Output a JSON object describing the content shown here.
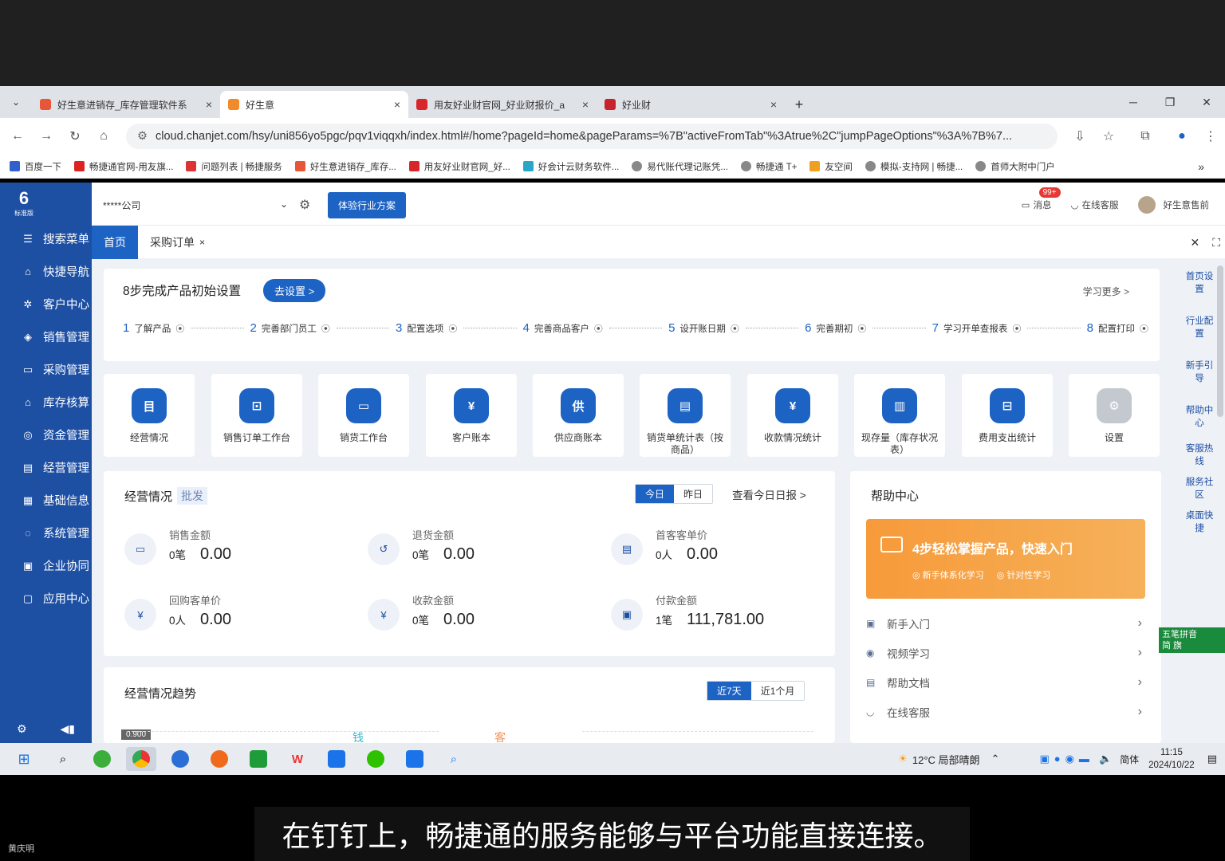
{
  "browser": {
    "tabs": [
      {
        "label": "好生意进销存_库存管理软件系",
        "color": "#e8563a"
      },
      {
        "label": "好生意",
        "color": "#f08a2a"
      },
      {
        "label": "用友好业财官网_好业财报价_a",
        "color": "#d8262b"
      },
      {
        "label": "好业财",
        "color": "#c8222d"
      }
    ],
    "url": "cloud.chanjet.com/hsy/uni856yo5pgc/pqv1viqqxh/index.html#/home?pageId=home&pageParams=%7B\"activeFromTab\"%3Atrue%2C\"jumpPageOptions\"%3A%7B%7...",
    "bookmarks": [
      "百度一下",
      "畅捷通官网-用友旗...",
      "问题列表 | 畅捷服务",
      "好生意进销存_库存...",
      "用友好业财官网_好...",
      "好会计云财务软件...",
      "易代账代理记账凭...",
      "畅捷通 T+",
      "友空间",
      "模拟-支持网 | 畅捷...",
      "首师大附中门户"
    ]
  },
  "sidebar": {
    "logo": "6",
    "logo_sub": "标准版",
    "items": [
      {
        "label": "搜索菜单",
        "icon": "☰"
      },
      {
        "label": "快捷导航",
        "icon": "⌂"
      },
      {
        "label": "客户中心",
        "icon": "✲"
      },
      {
        "label": "销售管理",
        "icon": "◈"
      },
      {
        "label": "采购管理",
        "icon": "▭"
      },
      {
        "label": "库存核算",
        "icon": "⌂"
      },
      {
        "label": "资金管理",
        "icon": "◎"
      },
      {
        "label": "经营管理",
        "icon": "▤"
      },
      {
        "label": "基础信息",
        "icon": "▦"
      },
      {
        "label": "系统管理",
        "icon": "◌"
      },
      {
        "label": "企业协同",
        "icon": "▣"
      },
      {
        "label": "应用中心",
        "icon": "▢"
      }
    ]
  },
  "header": {
    "company": "*****公司",
    "try_button": "体验行业方案",
    "badge": "99+",
    "messages": "消息",
    "service": "在线客服",
    "user": "好生意售前"
  },
  "page_tabs": {
    "home": "首页",
    "order": "采购订单"
  },
  "right_nav": [
    "首页设置",
    "行业配置",
    "新手引导",
    "帮助中心",
    "客服热线",
    "服务社区",
    "桌面快捷"
  ],
  "setup": {
    "title": "8步完成产品初始设置",
    "go": "去设置 >",
    "more": "学习更多 >",
    "steps": [
      {
        "n": "1",
        "label": "了解产品"
      },
      {
        "n": "2",
        "label": "完善部门员工"
      },
      {
        "n": "3",
        "label": "配置选项"
      },
      {
        "n": "4",
        "label": "完善商品客户"
      },
      {
        "n": "5",
        "label": "设开账日期"
      },
      {
        "n": "6",
        "label": "完善期初"
      },
      {
        "n": "7",
        "label": "学习开单查报表"
      },
      {
        "n": "8",
        "label": "配置打印"
      }
    ]
  },
  "tiles": [
    {
      "label": "经营情况",
      "icon": "目"
    },
    {
      "label": "销售订单工作台",
      "icon": "⊡"
    },
    {
      "label": "销货工作台",
      "icon": "▭"
    },
    {
      "label": "客户账本",
      "icon": "¥"
    },
    {
      "label": "供应商账本",
      "icon": "供"
    },
    {
      "label": "销货单统计表（按商品）",
      "icon": "▤"
    },
    {
      "label": "收款情况统计",
      "icon": "¥"
    },
    {
      "label": "现存量（库存状况表）",
      "icon": "▥"
    },
    {
      "label": "费用支出统计",
      "icon": "⊟"
    },
    {
      "label": "设置",
      "icon": "⚙"
    }
  ],
  "business": {
    "title": "经营情况",
    "tag": "批发",
    "today": "今日",
    "yesterday": "昨日",
    "report": "查看今日日报 >",
    "metrics": [
      {
        "label": "销售金额",
        "count": "0笔",
        "value": "0.00"
      },
      {
        "label": "退货金额",
        "count": "0笔",
        "value": "0.00"
      },
      {
        "label": "首客客单价",
        "count": "0人",
        "value": "0.00"
      },
      {
        "label": "回购客单价",
        "count": "0人",
        "value": "0.00"
      },
      {
        "label": "收款金额",
        "count": "0笔",
        "value": "0.00"
      },
      {
        "label": "付款金额",
        "count": "1笔",
        "value": "111,781.00"
      }
    ]
  },
  "trend": {
    "title": "经营情况趋势",
    "d7": "近7天",
    "m1": "近1个月",
    "tick": "0.900",
    "legend1": "钱",
    "legend2": "客"
  },
  "help": {
    "title": "帮助中心",
    "banner_title": "4步轻松掌握产品，快速入门",
    "banner_sub1": "新手体系化学习",
    "banner_sub2": "针对性学习",
    "items": [
      "新手入门",
      "视频学习",
      "帮助文档",
      "在线客服"
    ]
  },
  "ime": {
    "line1": "五笔拼音",
    "line2": "简 旗"
  },
  "taskbar": {
    "weather": "12°C 局部晴朗",
    "lang": "简体",
    "time": "11:15",
    "date": "2024/10/22"
  },
  "subtitle": "在钉钉上，畅捷通的服务能够与平台功能直接连接。",
  "watermark": "黄庆明"
}
